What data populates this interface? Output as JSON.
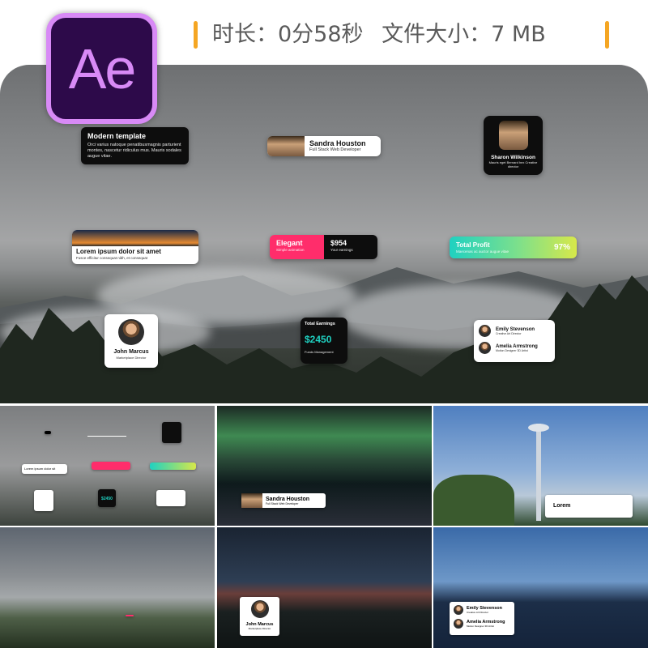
{
  "logo": {
    "text": "Ae"
  },
  "header": {
    "duration": "时长：0分58秒",
    "filesize": "文件大小：7 MB"
  },
  "cards": {
    "modern": {
      "title": "Modern template",
      "body": "Orci varius natoque penatibusmagnis parturient montes, nascetur ridiculus mus. Mauris sodales augue vitae."
    },
    "sandra": {
      "name": "Sandra Houston",
      "role": "Full Stack Web Developer"
    },
    "sharon": {
      "name": "Sharon Wilkinson",
      "role": "Mauris eget Bernard hex Creative director"
    },
    "lorem": {
      "title": "Lorem ipsum dolor sit amet",
      "sub": "Fusce efficitur consequat nibh, et consequat"
    },
    "elegant": {
      "title": "Elegant",
      "sub": "Simple animation",
      "value": "$954",
      "value_sub": "Your earnings"
    },
    "total_profit": {
      "title": "Total Profit",
      "sub": "Maecenas ac auctor augue vitae",
      "value": "97%"
    },
    "john": {
      "name": "John Marcus",
      "role": "Marketplace Director"
    },
    "earnings": {
      "title": "Total Earnings",
      "value": "$2450",
      "sub": "Funds Management"
    },
    "duo": {
      "p1_name": "Emily Stevenson",
      "p1_role": "Creative Art Director",
      "p2_name": "Amelia Armstrong",
      "p2_role": "Motion Designer 3D Artist"
    }
  },
  "thumbs": {
    "t1": {
      "lorem": "Lorem ipsum dolor sit",
      "value": "$2450"
    },
    "t2": {
      "name": "Sandra Houston",
      "role": "Full Stack Web Developer"
    },
    "t3": {
      "text": "Lorem"
    },
    "t5": {
      "name": "John Marcus",
      "role": "Marketplace Director"
    },
    "t6": {
      "p1_name": "Emily Stevenson",
      "p1_role": "Creative Art Director",
      "p2_name": "Amelia Armstrong",
      "p2_role": "Motion Designer 3D Artist"
    }
  },
  "colors": {
    "accent_orange": "#f5a623",
    "ae_purple": "#d88af6",
    "ae_bg": "#2d0a4a",
    "teal": "#1fd1c1",
    "pink": "#ff2d6b"
  }
}
